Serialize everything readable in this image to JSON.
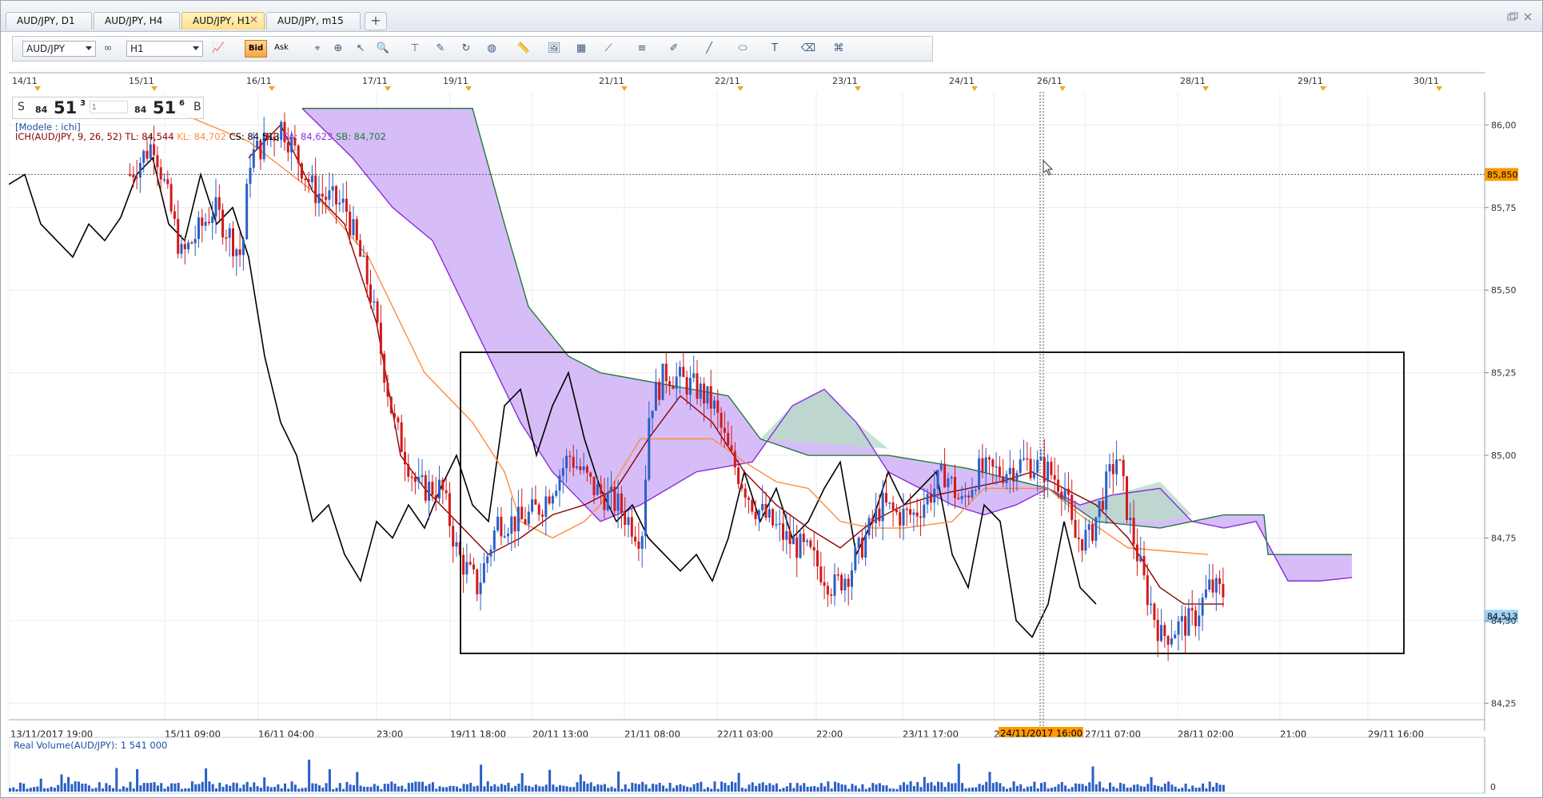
{
  "tabs": [
    {
      "label": "AUD/JPY, D1",
      "active": false
    },
    {
      "label": "AUD/JPY, H4",
      "active": false
    },
    {
      "label": "AUD/JPY, H1",
      "active": true
    },
    {
      "label": "AUD/JPY, m15",
      "active": false
    }
  ],
  "tab_close_glyph": "✕",
  "tab_add_glyph": "+",
  "toolbar": {
    "symbol": "AUD/JPY",
    "timeframe": "H1",
    "bid_label": "Bid",
    "ask_label": "Ask",
    "icons": [
      "link-icon",
      "chart-type-icon",
      "crosshair-icon",
      "zoom-in-icon",
      "zoom-out-icon",
      "cursor-icon",
      "magnifier-icon",
      "data-window-icon",
      "alert-icon",
      "refresh-icon",
      "globe-icon",
      "ruler-icon",
      "image-icon",
      "template-icon",
      "fibonacci-icon",
      "lines-icon",
      "pencil-icon",
      "line-tool-icon",
      "ellipse-icon",
      "text-tool-icon",
      "eraser-icon",
      "object-tree-icon"
    ]
  },
  "quote": {
    "sell_prefix": "S",
    "sell_big": "84",
    "sell_pips": "51",
    "sell_frac": "3",
    "buy_big": "84",
    "buy_pips": "51",
    "buy_frac": "6",
    "buy_suffix": "B",
    "lot_placeholder": "1"
  },
  "legend": {
    "model": "[Modele : ichi]",
    "ich": "ICH(AUD/JPY, 9, 26, 52)",
    "tl": "TL: 84,544",
    "kl": "KL: 84,702",
    "cs": "CS: 84,513",
    "sa": "SA: 84,623",
    "sb": "SB: 84,702"
  },
  "top_dates": [
    "14/11",
    "15/11",
    "16/11",
    "17/11",
    "19/11",
    "21/11",
    "22/11",
    "23/11",
    "24/11",
    "26/11",
    "28/11",
    "29/11",
    "30/11"
  ],
  "bottom_times": [
    "13/11/2017 19:00",
    "15/11 09:00",
    "16/11 04:00",
    "23:00",
    "19/11 18:00",
    "20/11 13:00",
    "21/11 08:00",
    "22/11 03:00",
    "22:00",
    "23/11 17:00",
    "2",
    "27/11 07:00",
    "28/11 02:00",
    "21:00",
    "29/11 16:00"
  ],
  "crosshair_time_label": "24/11/2017 16:00",
  "price_labels": [
    "86,00",
    "85,75",
    "85,50",
    "85,25",
    "85,00",
    "84,75",
    "84,50",
    "84,25"
  ],
  "crosshair_price_label": "85,850",
  "last_price_label": "84,513",
  "volume": {
    "title": "Real Volume(AUD/JPY): 1 541 000",
    "axis_zero": "0"
  },
  "colors": {
    "bull": "#2a5fc6",
    "bear": "#d11a1a",
    "tenkan": "#8b0000",
    "kijun": "#ff8c3a",
    "chikou": "#000000",
    "senkou_a": "#8a2be2",
    "senkou_b": "#1f7a3a",
    "cloud_bear": "#c9a7f5",
    "cloud_bull": "#b7dcc4",
    "crosshair_label_bg": "#ff9900",
    "last_label_bg": "#9fd5ff"
  },
  "chart_data": {
    "type": "candlestick",
    "symbol": "AUD/JPY",
    "timeframe": "H1",
    "ylim": [
      84.2,
      86.1
    ],
    "crosshair_price": 85.85,
    "last_price": 84.513,
    "indicators": {
      "tenkan": 84.544,
      "kijun": 84.702,
      "chikou": 84.513,
      "senkou_a": 84.623,
      "senkou_b": 84.702
    },
    "rectangle": {
      "price_top": 85.28,
      "price_bottom": 84.4
    }
  }
}
